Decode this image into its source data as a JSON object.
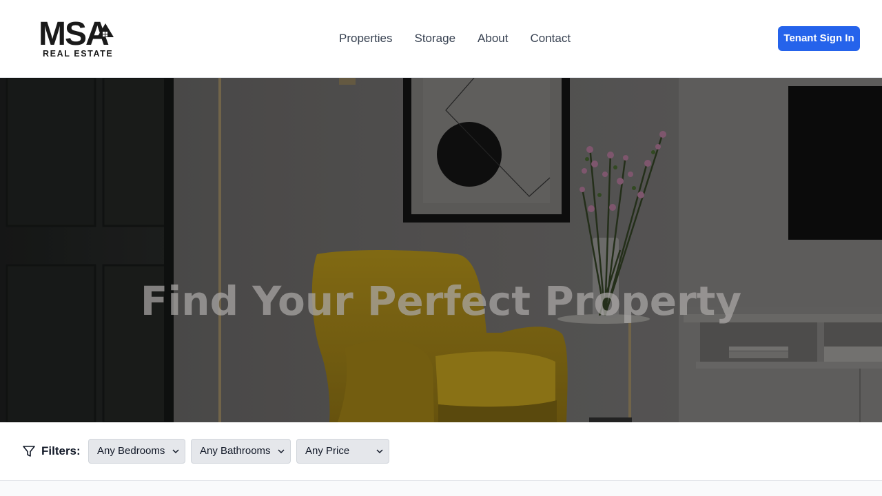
{
  "brand": {
    "mark": "MSA",
    "sub": "REAL ESTATE"
  },
  "nav": {
    "items": [
      "Properties",
      "Storage",
      "About",
      "Contact"
    ]
  },
  "header": {
    "signin_label": "Tenant Sign In"
  },
  "hero": {
    "title": "Find Your Perfect Property"
  },
  "filters": {
    "label": "Filters:",
    "bedrooms": "Any Bedrooms",
    "bathrooms": "Any Bathrooms",
    "price": "Any Price"
  },
  "colors": {
    "accent": "#2563eb",
    "chair": "#b8961a"
  },
  "icons": {
    "filter": "filter-icon",
    "chevron": "chevron-down-icon",
    "house": "house-icon"
  }
}
